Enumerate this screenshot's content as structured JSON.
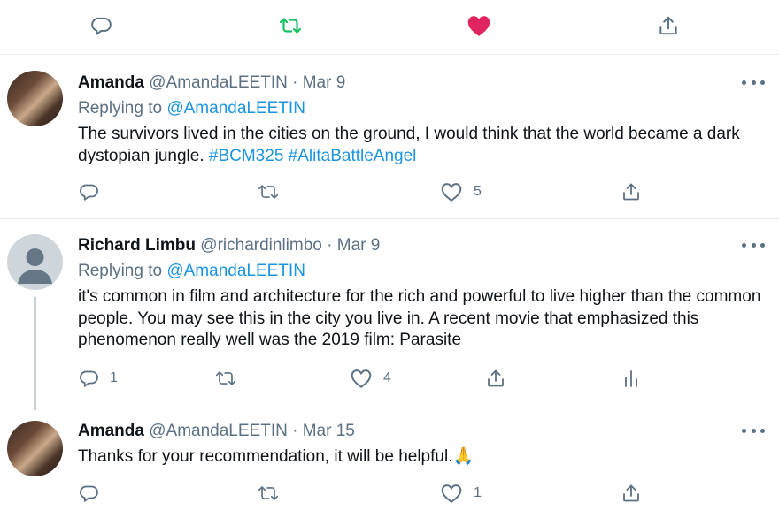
{
  "colors": {
    "retweet_active": "#17bf63",
    "like_active": "#e0245e",
    "link": "#1b95e0",
    "muted": "#5b7083"
  },
  "top_actions": {
    "reply_icon": "comment-icon",
    "retweet_icon": "retweet-icon",
    "like_icon": "heart-icon",
    "share_icon": "share-icon"
  },
  "tweets": [
    {
      "name": "Amanda",
      "handle": "@AmandaLEETIN",
      "separator": "·",
      "date": "Mar 9",
      "replying_prefix": "Replying to",
      "replying_to": "@AmandaLEETIN",
      "text_before": "The survivors lived in the cities on the ground, I would think that the world became a dark dystopian jungle. ",
      "hashtag_1": "#BCM325",
      "hashtag_2": "#AlitaBattleAngel",
      "reply_count": "",
      "retweet_count": "",
      "like_count": "5"
    },
    {
      "name": "Richard Limbu",
      "handle": "@richardinlimbo",
      "separator": "·",
      "date": "Mar 9",
      "replying_prefix": "Replying to",
      "replying_to": "@AmandaLEETIN",
      "text": "it's common in film and architecture for the rich and powerful to live higher than the common people. You may see this in the city you live in. A recent movie that emphasized this phenomenon really well was the 2019 film: Parasite",
      "reply_count": "1",
      "retweet_count": "",
      "like_count": "4"
    },
    {
      "name": "Amanda",
      "handle": "@AmandaLEETIN",
      "separator": "·",
      "date": "Mar 15",
      "text": "Thanks for your recommendation, it will be helpful.",
      "emoji": "🙏",
      "reply_count": "",
      "retweet_count": "",
      "like_count": "1"
    }
  ]
}
